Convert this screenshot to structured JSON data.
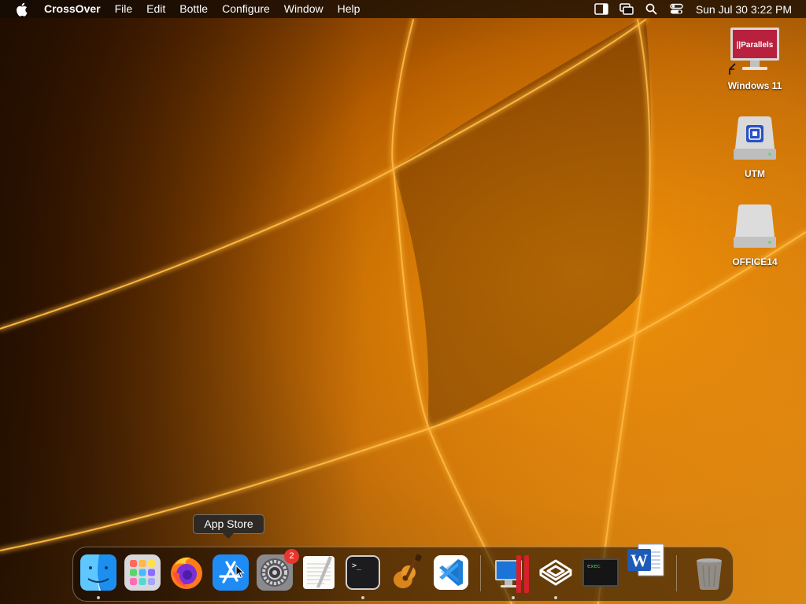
{
  "menubar": {
    "apple_icon": "apple-icon",
    "app_name": "CrossOver",
    "menus": [
      "File",
      "Edit",
      "Bottle",
      "Configure",
      "Window",
      "Help"
    ],
    "status_icons": [
      "sidebar-icon",
      "screen-mirroring-icon",
      "search-icon",
      "control-center-icon"
    ],
    "clock": "Sun Jul 30  3:22 PM"
  },
  "desktop": {
    "icons": [
      {
        "label": "Windows 11",
        "icon": "parallels-vm-icon",
        "badge_text": "||Parallels"
      },
      {
        "label": "UTM",
        "icon": "utm-disk-icon"
      },
      {
        "label": "OFFICE14",
        "icon": "external-disk-icon"
      }
    ]
  },
  "dock": {
    "tooltip": "App Store",
    "apps": [
      {
        "name": "Finder",
        "icon": "finder-icon",
        "running": true
      },
      {
        "name": "Launchpad",
        "icon": "launchpad-icon",
        "running": false
      },
      {
        "name": "Firefox",
        "icon": "firefox-icon",
        "running": false
      },
      {
        "name": "App Store",
        "icon": "app-store-icon",
        "running": false
      },
      {
        "name": "System Settings",
        "icon": "system-settings-icon",
        "running": false,
        "badge": "2"
      },
      {
        "name": "TextEdit",
        "icon": "textedit-icon",
        "running": false
      },
      {
        "name": "Terminal",
        "icon": "terminal-icon",
        "running": true
      },
      {
        "name": "GarageBand",
        "icon": "garageband-icon",
        "running": false
      },
      {
        "name": "Visual Studio Code",
        "icon": "vscode-icon",
        "running": false
      },
      {
        "name": "Parallels Desktop",
        "icon": "parallels-icon",
        "running": true
      },
      {
        "name": "CrossOver",
        "icon": "crossover-icon",
        "running": true
      },
      {
        "name": "exec",
        "icon": "exec-terminal-icon",
        "running": false,
        "label": "exec"
      },
      {
        "name": "Microsoft Word",
        "icon": "word-icon",
        "running": false
      },
      {
        "name": "Trash",
        "icon": "trash-icon",
        "running": false
      }
    ]
  },
  "colors": {
    "wallpaper_dark": "#2a1200",
    "wallpaper_mid": "#b85e00",
    "wallpaper_light": "#f08c00",
    "accent_glow": "#ffb940"
  }
}
